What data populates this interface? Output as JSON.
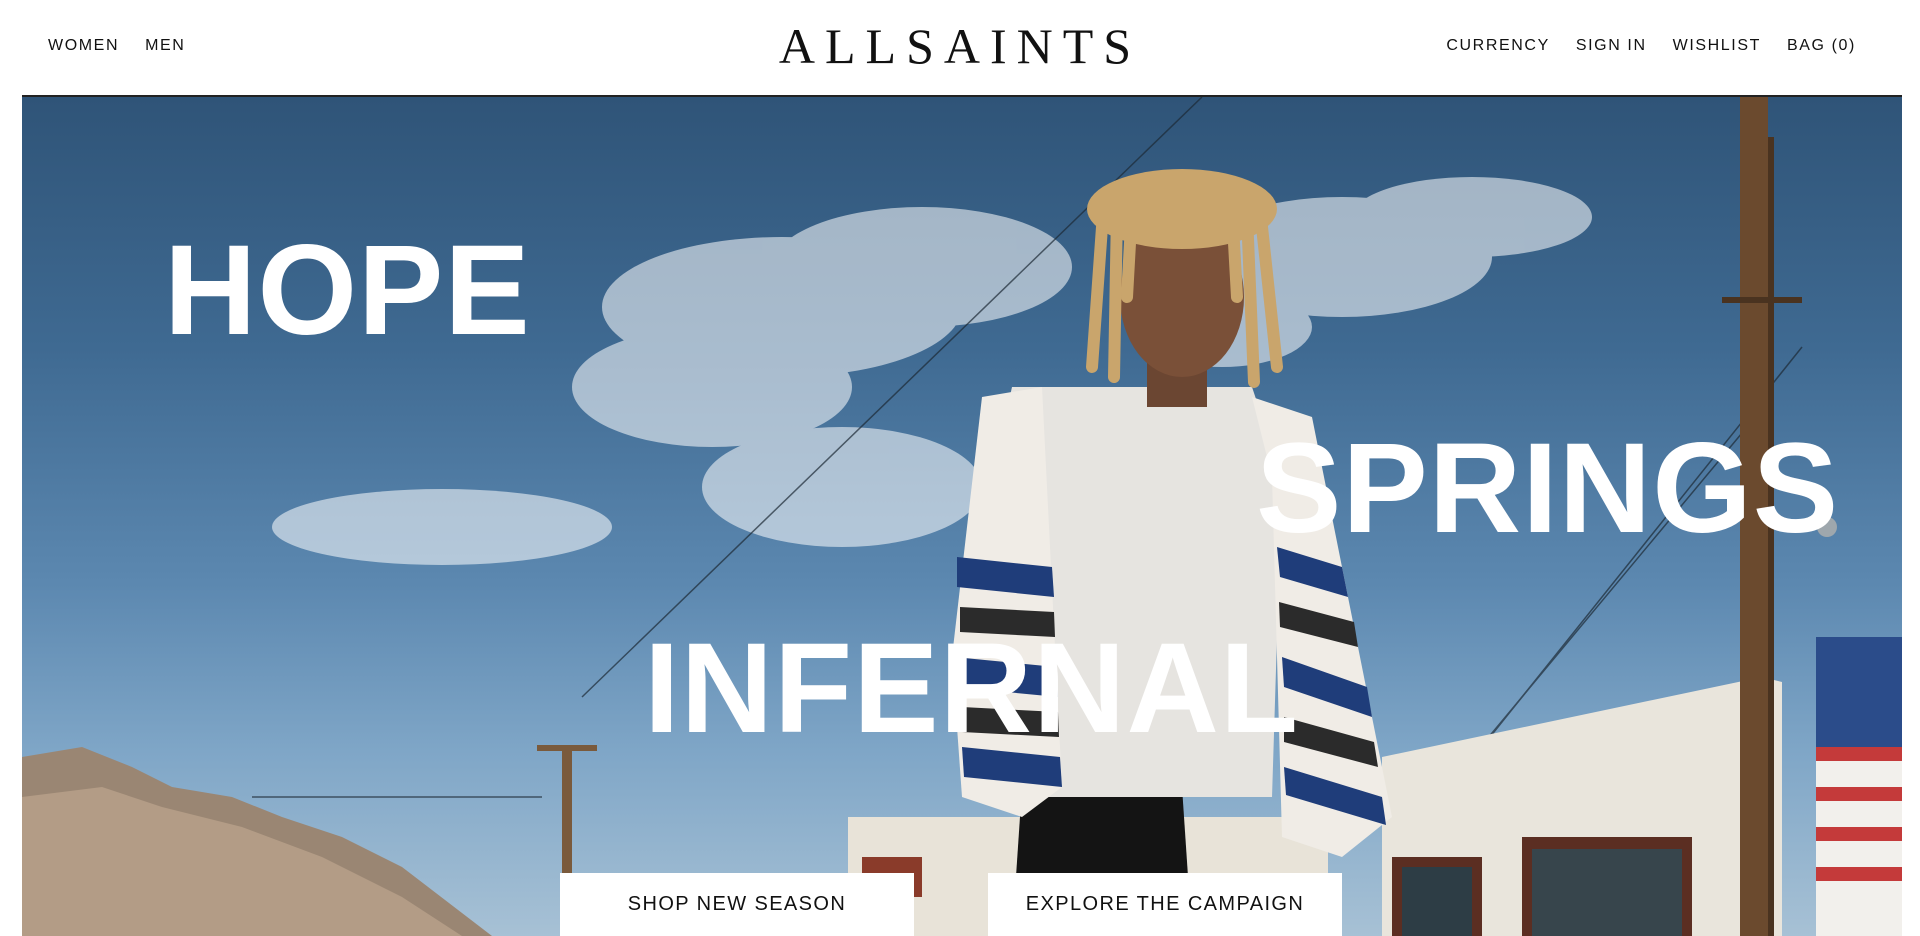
{
  "header": {
    "nav_left": [
      "WOMEN",
      "MEN"
    ],
    "logo": "ALLSAINTS",
    "nav_right": [
      "CURRENCY",
      "SIGN IN",
      "WISHLIST",
      "BAG (0)"
    ]
  },
  "hero": {
    "headline_1": "HOPE",
    "headline_2": "SPRINGS",
    "headline_3": "INFERNAL",
    "cta_primary": "SHOP NEW SEASON",
    "cta_secondary": "EXPLORE THE CAMPAIGN"
  },
  "colors": {
    "sky": "#3f6a92",
    "text_on_image": "#ffffff",
    "button_bg": "#ffffff"
  }
}
